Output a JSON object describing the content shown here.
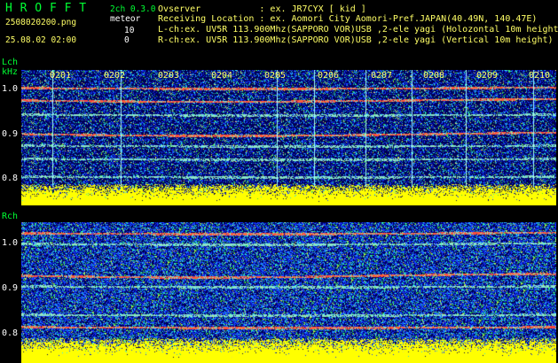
{
  "header": {
    "brand": "H R O F F T",
    "filename": "2508020200.png",
    "timestamp": "25.08.02 02:00",
    "mode": "2ch 0.3.0",
    "meteor_label": "meteor",
    "lch_count": "10",
    "rch_count": "0",
    "observer_line": "Ovserver           : ex. JR7CYX [ kid ]",
    "location_line": "Receiving Location : ex. Aomori City Aomori-Pref.JAPAN(40.49N, 140.47E)",
    "lch_line": "L-ch:ex. UV5R 113.900Mhz(SAPPORO VOR)USB ,2-ele yagi (Holozontal 10m height)",
    "rch_line": "R-ch:ex. UV5R 113.900Mhz(SAPPORO VOR)USB ,2-ele yagi (Vertical 10m height)"
  },
  "lch": {
    "label": "Lch",
    "unit": "kHz",
    "y_ticks": [
      "1.0",
      "0.9",
      "0.8"
    ],
    "x_ticks": [
      "0201",
      "0202",
      "0203",
      "0204",
      "0205",
      "0206",
      "0207",
      "0208",
      "0209",
      "0210"
    ]
  },
  "rch": {
    "label": "Rch",
    "y_ticks": [
      "1.0",
      "0.9",
      "0.8"
    ]
  },
  "colors": {
    "background": "#000000",
    "text_green": "#00ff33",
    "text_yellow": "#ffff66",
    "noise_deep": "#000066",
    "noise_blue": "#1a33ff",
    "signal_red": "#ff3030",
    "level_yellow": "#ffff00"
  }
}
